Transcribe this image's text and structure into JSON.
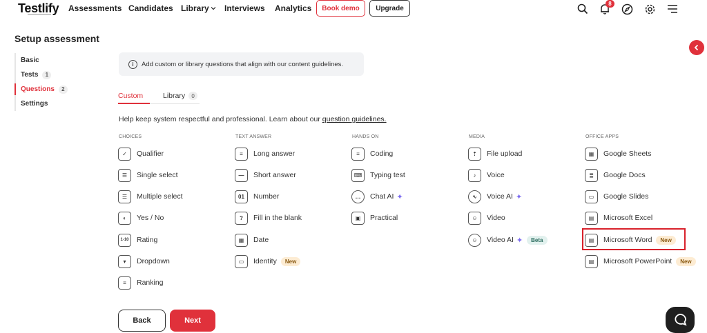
{
  "brand": {
    "logo": "Testlify"
  },
  "nav": {
    "links": [
      "Assessments",
      "Candidates",
      "Library",
      "Interviews",
      "Analytics"
    ],
    "book_demo": "Book demo",
    "upgrade": "Upgrade",
    "notification_count": "8"
  },
  "page": {
    "title": "Setup assessment"
  },
  "steps": [
    {
      "label": "Basic",
      "count": ""
    },
    {
      "label": "Tests",
      "count": "1"
    },
    {
      "label": "Questions",
      "count": "2"
    },
    {
      "label": "Settings",
      "count": ""
    }
  ],
  "info": {
    "text": "Add custom or library questions that align with our content guidelines."
  },
  "tabs": {
    "custom": "Custom",
    "library": "Library",
    "library_count": "0"
  },
  "help": {
    "text": "Help keep system respectful and professional. Learn about our",
    "link": "question guidelines."
  },
  "columns": {
    "choices": {
      "title": "CHOICES",
      "items": [
        "Qualifier",
        "Single select",
        "Multiple select",
        "Yes / No",
        "Rating",
        "Dropdown",
        "Ranking"
      ]
    },
    "text_answer": {
      "title": "TEXT ANSWER",
      "items": [
        "Long answer",
        "Short answer",
        "Number",
        "Fill in the blank",
        "Date",
        "Identity"
      ],
      "identity_tag": "New"
    },
    "hands_on": {
      "title": "HANDS ON",
      "items": [
        "Coding",
        "Typing test",
        "Chat AI",
        "Practical"
      ]
    },
    "media": {
      "title": "MEDIA",
      "items": [
        "File upload",
        "Voice",
        "Voice AI",
        "Video",
        "Video AI"
      ],
      "video_ai_tag": "Beta"
    },
    "office_apps": {
      "title": "OFFICE APPS",
      "items": [
        "Google Sheets",
        "Google Docs",
        "Google Slides",
        "Microsoft Excel",
        "Microsoft Word",
        "Microsoft PowerPoint"
      ],
      "word_tag": "New",
      "powerpoint_tag": "New"
    }
  },
  "buttons": {
    "back": "Back",
    "next": "Next"
  }
}
